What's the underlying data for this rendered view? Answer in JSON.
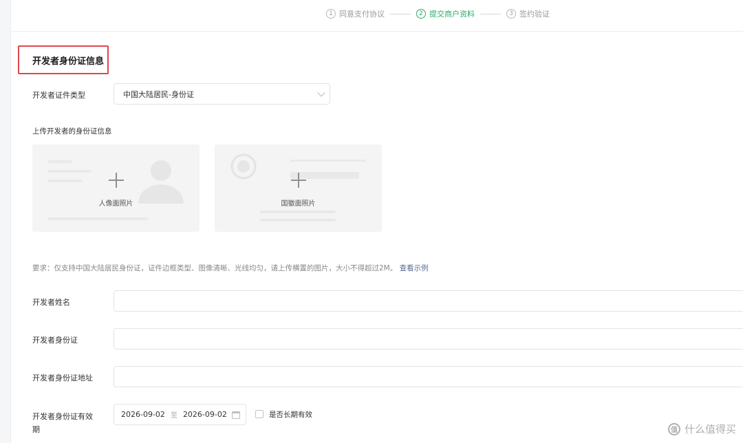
{
  "stepper": {
    "steps": [
      {
        "num": "1",
        "label": "同意支付协议",
        "active": false
      },
      {
        "num": "2",
        "label": "提交商户资料",
        "active": true
      },
      {
        "num": "3",
        "label": "签约验证",
        "active": false
      }
    ]
  },
  "section": {
    "title": "开发者身份证信息"
  },
  "id_type": {
    "label": "开发者证件类型",
    "value": "中国大陆居民-身份证"
  },
  "upload": {
    "label": "上传开发者的身份证信息",
    "front_caption": "人像面照片",
    "back_caption": "国徽面照片"
  },
  "requirement": {
    "text": "要求：仅支持中国大陆居民身份证，证件边框类型、图像清晰、光线均匀，请上传横置的图片，大小不得超过2M。",
    "link": "查看示例"
  },
  "form": {
    "name_label": "开发者姓名",
    "id_number_label": "开发者身份证",
    "address_label": "开发者身份证地址",
    "validity_label_line1": "开发者身份证有效",
    "validity_label_line2": "期",
    "date_start": "2026-09-02",
    "date_sep": "至",
    "date_end": "2026-09-02",
    "long_term_label": "是否长期有效"
  },
  "watermark": {
    "text": "什么值得买",
    "logo_char": "值"
  },
  "colors": {
    "accent_green": "#2aae67",
    "highlight_red": "#e0464c",
    "link_blue": "#576b95"
  }
}
